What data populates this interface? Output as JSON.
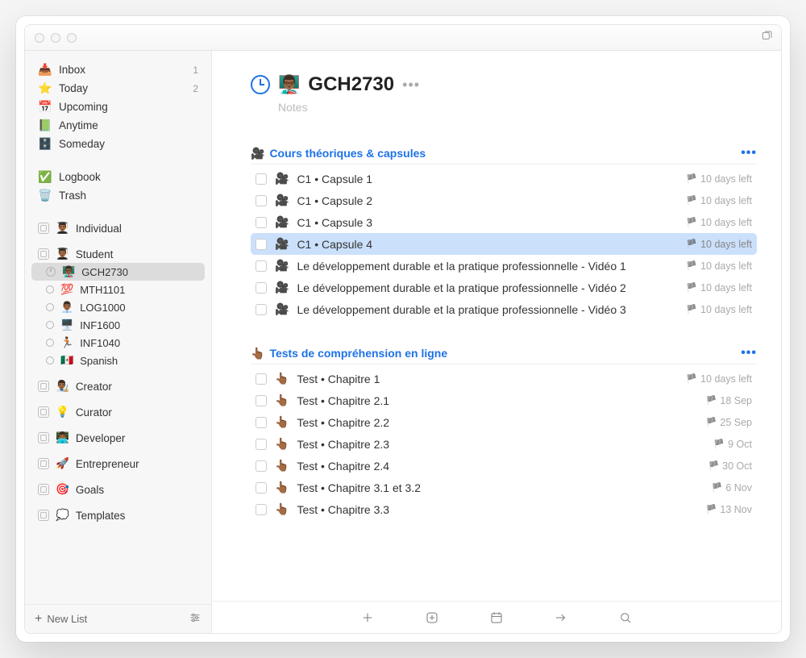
{
  "sidebar": {
    "smartLists": [
      {
        "icon": "📥",
        "label": "Inbox",
        "count": 1,
        "color": "#fff",
        "bgcolor": "#2c99f2"
      },
      {
        "icon": "⭐",
        "label": "Today",
        "count": 2
      },
      {
        "icon": "📅",
        "label": "Upcoming"
      },
      {
        "icon": "📗",
        "label": "Anytime"
      },
      {
        "icon": "🗄️",
        "label": "Someday"
      }
    ],
    "log": [
      {
        "icon": "✅",
        "label": "Logbook"
      },
      {
        "icon": "🗑️",
        "label": "Trash"
      }
    ],
    "areas": [
      {
        "emoji": "👨🏾‍🎓",
        "label": "Individual",
        "projects": []
      },
      {
        "emoji": "👨🏾‍🎓",
        "label": "Student",
        "projects": [
          {
            "emoji": "👨🏾‍🏫",
            "label": "GCH2730",
            "selected": true,
            "hasDeadline": true
          },
          {
            "emoji": "💯",
            "label": "MTH1101"
          },
          {
            "emoji": "👨🏾‍💼",
            "label": "LOG1000"
          },
          {
            "emoji": "🖥️",
            "label": "INF1600"
          },
          {
            "emoji": "🏃🏾",
            "label": "INF1040"
          },
          {
            "emoji": "🇲🇽",
            "label": "Spanish"
          }
        ]
      },
      {
        "emoji": "👨🏾‍🎨",
        "label": "Creator"
      },
      {
        "emoji": "💡",
        "label": "Curator"
      },
      {
        "emoji": "👨🏾‍💻",
        "label": "Developer"
      },
      {
        "emoji": "🚀",
        "label": "Entrepreneur"
      },
      {
        "emoji": "🎯",
        "label": "Goals"
      },
      {
        "emoji": "💭",
        "label": "Templates"
      }
    ],
    "newList": "New List"
  },
  "main": {
    "projectEmoji": "👨🏾‍🏫",
    "projectTitle": "GCH2730",
    "notesPlaceholder": "Notes",
    "sections": [
      {
        "emoji": "🎥",
        "title": "Cours théoriques & capsules",
        "tasks": [
          {
            "emoji": "🎥",
            "title": "C1 • Capsule 1",
            "deadline": "10 days left"
          },
          {
            "emoji": "🎥",
            "title": "C1 • Capsule 2",
            "deadline": "10 days left"
          },
          {
            "emoji": "🎥",
            "title": "C1 • Capsule 3",
            "deadline": "10 days left"
          },
          {
            "emoji": "🎥",
            "title": "C1 • Capsule 4",
            "deadline": "10 days left",
            "selected": true
          },
          {
            "emoji": "🎥",
            "title": "Le développement durable et la pratique professionnelle - Vidéo 1",
            "deadline": "10 days left"
          },
          {
            "emoji": "🎥",
            "title": "Le développement durable et la pratique professionnelle - Vidéo 2",
            "deadline": "10 days left"
          },
          {
            "emoji": "🎥",
            "title": "Le développement durable et la pratique professionnelle - Vidéo 3",
            "deadline": "10 days left"
          }
        ]
      },
      {
        "emoji": "👆🏾",
        "title": "Tests de compréhension en ligne",
        "tasks": [
          {
            "emoji": "👆🏾",
            "title": "Test • Chapitre 1",
            "deadline": "10 days left"
          },
          {
            "emoji": "👆🏾",
            "title": "Test • Chapitre 2.1",
            "deadline": "18 Sep"
          },
          {
            "emoji": "👆🏾",
            "title": "Test • Chapitre 2.2",
            "deadline": "25 Sep"
          },
          {
            "emoji": "👆🏾",
            "title": "Test • Chapitre 2.3",
            "deadline": "9 Oct"
          },
          {
            "emoji": "👆🏾",
            "title": "Test • Chapitre 2.4",
            "deadline": "30 Oct"
          },
          {
            "emoji": "👆🏾",
            "title": "Test • Chapitre 3.1 et 3.2",
            "deadline": "6 Nov"
          },
          {
            "emoji": "👆🏾",
            "title": "Test • Chapitre 3.3",
            "deadline": "13 Nov"
          }
        ]
      }
    ]
  }
}
